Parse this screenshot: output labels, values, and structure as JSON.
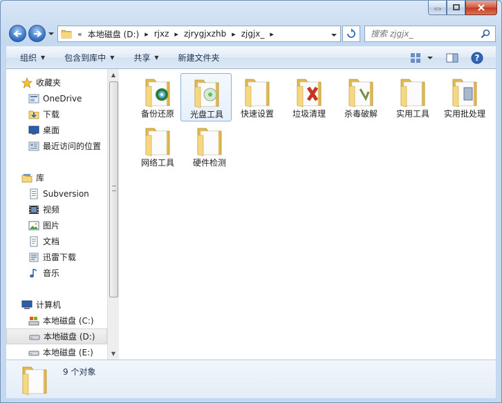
{
  "address": {
    "overflow_glyph": "«",
    "separator": "▸",
    "crumbs": [
      "本地磁盘 (D:)",
      "rjxz",
      "zjrygjxzhb",
      "zjgjx_"
    ]
  },
  "search": {
    "placeholder": "搜索 zjgjx_"
  },
  "toolbar": {
    "organize": "组织",
    "include_in_library": "包含到库中",
    "share": "共享",
    "new_folder": "新建文件夹",
    "dropdown_glyph": "▼"
  },
  "nav": {
    "favorites": {
      "header": "收藏夹",
      "items": [
        "OneDrive",
        "下载",
        "桌面",
        "最近访问的位置"
      ]
    },
    "libraries": {
      "header": "库",
      "items": [
        "Subversion",
        "视频",
        "图片",
        "文档",
        "迅雷下载",
        "音乐"
      ]
    },
    "computer": {
      "header": "计算机",
      "items": [
        "本地磁盘 (C:)",
        "本地磁盘 (D:)",
        "本地磁盘 (E:)"
      ],
      "selected_index": 1
    }
  },
  "files": [
    {
      "name": "备份还原",
      "overlay": "disc"
    },
    {
      "name": "光盘工具",
      "overlay": "cd",
      "selected": true
    },
    {
      "name": "快速设置",
      "overlay": "none"
    },
    {
      "name": "垃圾清理",
      "overlay": "tools"
    },
    {
      "name": "杀毒破解",
      "overlay": "shield"
    },
    {
      "name": "实用工具",
      "overlay": "none"
    },
    {
      "name": "实用批处理",
      "overlay": "gear"
    },
    {
      "name": "网络工具",
      "overlay": "none"
    },
    {
      "name": "硬件检测",
      "overlay": "none"
    }
  ],
  "status": {
    "item_count": "9 个对象"
  },
  "colors": {
    "selection_border": "#86b2e3",
    "folder": "#f3d47c",
    "accent": "#3b78c7"
  }
}
